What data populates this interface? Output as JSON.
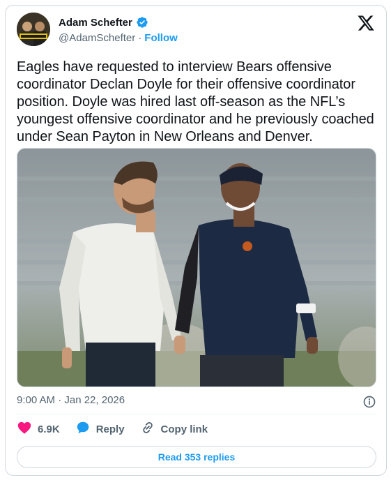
{
  "author": {
    "display_name": "Adam Schefter",
    "handle": "@AdamSchefter",
    "separator": "·",
    "follow_label": "Follow",
    "verified_color": "#1d9bf0"
  },
  "tweet": {
    "text": "Eagles have requested to interview Bears offensive coordinator Declan Doyle for their offensive coordinator position. Doyle was hired last off-season as the NFL’s youngest offensive coordinator and he previously coached under Sean Payton in New Orleans and Denver.",
    "timestamp": "9:00 AM · Jan 22, 2026"
  },
  "media": {
    "description_icon": "photo-two-coaches-smiling"
  },
  "actions": {
    "like_count": "6.9K",
    "reply_label": "Reply",
    "copy_link_label": "Copy link"
  },
  "footer": {
    "read_replies_label": "Read 353 replies"
  },
  "colors": {
    "accent": "#1d9bf0",
    "like": "#f91880",
    "muted": "#536471",
    "border": "#cfd9de"
  }
}
